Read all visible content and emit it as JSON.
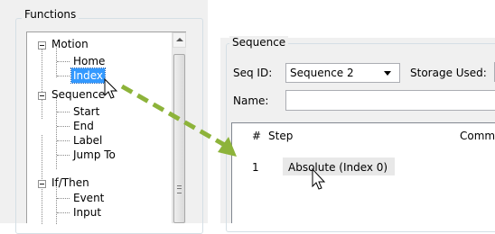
{
  "functions": {
    "title": "Functions",
    "tree": {
      "motion": "Motion",
      "home": "Home",
      "index": "Index",
      "sequence": "Sequence",
      "start": "Start",
      "end": "End",
      "label": "Label",
      "jump_to": "Jump To",
      "if_then": "If/Then",
      "event": "Event",
      "input": "Input"
    }
  },
  "sequence": {
    "title": "Sequence",
    "seq_id_label": "Seq ID:",
    "seq_id_value": "Sequence 2",
    "storage_used_label": "Storage Used:",
    "name_label": "Name:",
    "name_value": "",
    "columns": {
      "number": "#",
      "step": "Step",
      "comment": "Comm"
    },
    "rows": [
      {
        "number": "1",
        "step": "Absolute (Index 0)"
      }
    ]
  },
  "colors": {
    "selection": "#3399ff",
    "drag_arrow": "#8db33a"
  },
  "icons": [
    "collapse-icon",
    "scroll-up-icon",
    "dropdown-arrow-icon",
    "mouse-cursor-icon",
    "drag-arrow-icon"
  ]
}
